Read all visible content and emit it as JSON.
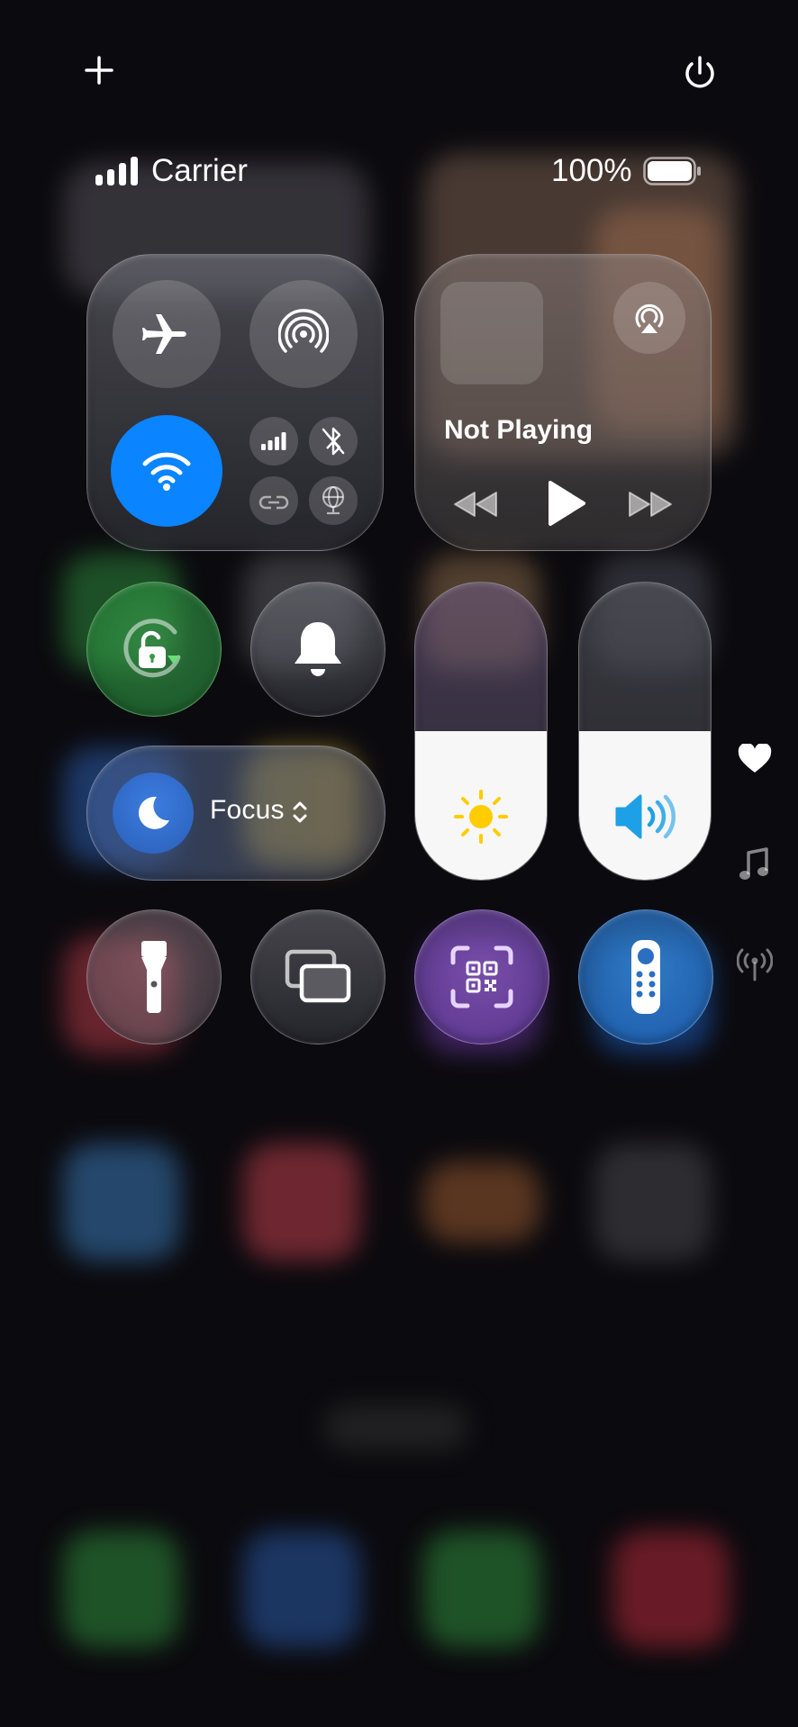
{
  "status_bar": {
    "carrier": "Carrier",
    "battery_percent": "100%"
  },
  "top_controls": {
    "add_icon": "plus-icon",
    "power_icon": "power-icon"
  },
  "connectivity": {
    "airplane": "airplane-icon",
    "airdrop": "airdrop-icon",
    "wifi": "wifi-icon",
    "wifi_on": true,
    "cellular": "cellular-icon",
    "bluetooth": "bluetooth-off-icon",
    "hotspot": "personal-hotspot-icon",
    "vpn": "vpn-globe-icon"
  },
  "now_playing": {
    "title": "Not Playing",
    "airplay": "airplay-icon",
    "rewind": "rewind-icon",
    "play": "play-icon",
    "forward": "fast-forward-icon"
  },
  "focus": {
    "label": "Focus",
    "icon": "moon-icon"
  },
  "sliders": {
    "brightness_level": 0.5,
    "volume_level": 0.5
  },
  "side_indicators": [
    "heart-icon",
    "music-note-icon",
    "antenna-icon"
  ],
  "colors": {
    "wifi_blue": "#0a84ff",
    "orientation_green": "#2fa84f",
    "sun_yellow": "#ffcc00",
    "speaker_blue": "#1ea0e6",
    "qr_purple": "#8e5bd0",
    "remote_blue": "#2a8ae6"
  }
}
